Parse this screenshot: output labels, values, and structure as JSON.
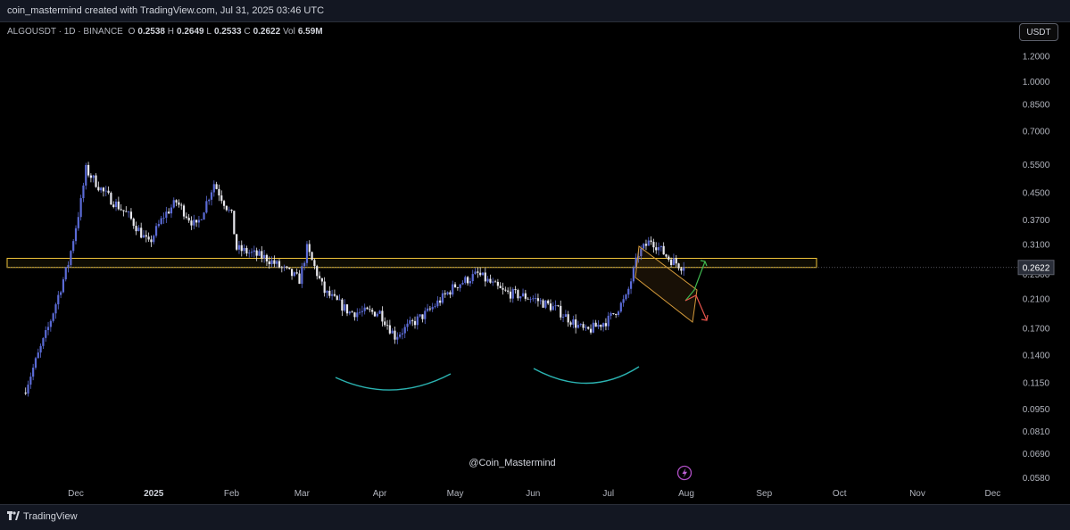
{
  "header": {
    "credit": "coin_mastermind created with TradingView.com, Jul 31, 2025 03:46 UTC"
  },
  "legend": {
    "symbol": "ALGOUSDT · 1D · BINANCE",
    "open_label": "O",
    "open": "0.2538",
    "high_label": "H",
    "high": "0.2649",
    "low_label": "L",
    "low": "0.2533",
    "close_label": "C",
    "close": "0.2622",
    "vol_label": "Vol",
    "vol": "6.59M"
  },
  "currency_button": "USDT",
  "watermark": "@Coin_Mastermind",
  "footer": {
    "brand": "TradingView"
  },
  "colors": {
    "up": "#5b6bd6",
    "down": "#e8e8ee",
    "zone": "#f0c43a",
    "arc": "#2bb3b1",
    "target_up": "#3fb950",
    "target_down": "#e5534b",
    "price_tag": "#2a2e39"
  },
  "icons": {
    "lightning": "lightning-icon",
    "logo": "tradingview-logo-icon"
  },
  "chart_data": {
    "type": "candlestick",
    "scale": "log",
    "price_labels": [
      "1.2000",
      "1.0000",
      "0.8500",
      "0.7000",
      "0.5500",
      "0.4500",
      "0.3700",
      "0.3100",
      "0.2500",
      "0.2100",
      "0.1700",
      "0.1400",
      "0.1150",
      "0.0950",
      "0.0810",
      "0.0690",
      "0.0580"
    ],
    "last_price": "0.2622",
    "x_labels": [
      "Dec",
      "2025",
      "Feb",
      "Mar",
      "Apr",
      "May",
      "Jun",
      "Jul",
      "Aug",
      "Sep",
      "Oct",
      "Nov",
      "Dec"
    ],
    "zone": {
      "low": 0.2622,
      "high": 0.28
    },
    "approx_close_path": [
      [
        "Nov 11",
        0.11
      ],
      [
        "Nov 20",
        0.17
      ],
      [
        "Nov 28",
        0.27
      ],
      [
        "Dec 3",
        0.42
      ],
      [
        "Dec 5",
        0.53
      ],
      [
        "Dec 12",
        0.45
      ],
      [
        "Dec 22",
        0.38
      ],
      [
        "Dec 30",
        0.31
      ],
      [
        "Jan 5",
        0.38
      ],
      [
        "Jan 10",
        0.42
      ],
      [
        "Jan 18",
        0.35
      ],
      [
        "Jan 25",
        0.48
      ],
      [
        "Feb 1",
        0.38
      ],
      [
        "Feb 3",
        0.3
      ],
      [
        "Feb 15",
        0.28
      ],
      [
        "Feb 28",
        0.24
      ],
      [
        "Mar 3",
        0.3
      ],
      [
        "Mar 10",
        0.22
      ],
      [
        "Mar 20",
        0.19
      ],
      [
        "Apr 1",
        0.19
      ],
      [
        "Apr 7",
        0.16
      ],
      [
        "Apr 20",
        0.19
      ],
      [
        "May 1",
        0.23
      ],
      [
        "May 10",
        0.25
      ],
      [
        "May 20",
        0.22
      ],
      [
        "Jun 1",
        0.21
      ],
      [
        "Jun 10",
        0.195
      ],
      [
        "Jun 22",
        0.165
      ],
      [
        "Jul 1",
        0.18
      ],
      [
        "Jul 8",
        0.21
      ],
      [
        "Jul 13",
        0.29
      ],
      [
        "Jul 18",
        0.32
      ],
      [
        "Jul 25",
        0.28
      ],
      [
        "Jul 31",
        0.2622
      ]
    ],
    "annotations": [
      "rounded bottom arc Mar–May",
      "rounded bottom arc Jun–Jul",
      "descending channel mid-Jul to Aug",
      "up arrow target",
      "down arrow target"
    ]
  }
}
